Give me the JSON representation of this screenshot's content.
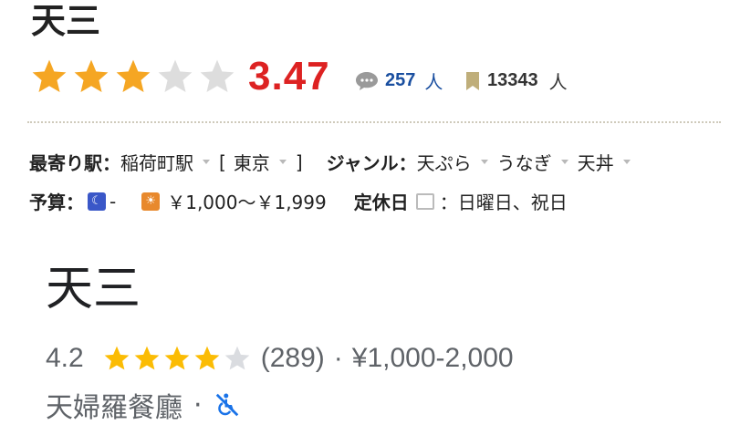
{
  "tabelog": {
    "name": "天三",
    "rating": "3.47",
    "stars_filled": 3,
    "stars_total": 5,
    "review_count": "257",
    "review_unit": "人",
    "save_count": "13343",
    "save_unit": "人",
    "station_label": "最寄り駅：",
    "station_value": "稲荷町駅",
    "area_open": "[",
    "area_value": "東京",
    "area_close": "]",
    "genre_label": "ジャンル：",
    "genres": [
      "天ぷら",
      "うなぎ",
      "天丼"
    ],
    "budget_label": "予算：",
    "budget_dinner": "-",
    "budget_lunch": "￥1,000～￥1,999",
    "holiday_label": "定休日",
    "holiday_colon": "：",
    "holiday_value": "日曜日、祝日",
    "colors": {
      "rating": "#dd2222",
      "star": "#f5a623",
      "star_empty": "#dddddd",
      "link": "#1a4fa0"
    },
    "icons": [
      "speech-bubble-icon",
      "bookmark-icon",
      "moon-icon",
      "sun-icon",
      "calendar-note-icon",
      "dropdown-arrow-icon"
    ]
  },
  "google": {
    "name": "天三",
    "rating": "4.2",
    "stars_filled": 4,
    "stars_total": 5,
    "review_count": "(289)",
    "separator": "·",
    "price_range": "¥1,000-2,000",
    "category": "天婦羅餐廳",
    "category_sep": "·",
    "colors": {
      "star": "#fbbc04",
      "star_empty": "#dadce0",
      "accessibility": "#1a73e8"
    },
    "icons": [
      "not-wheelchair-accessible-icon"
    ]
  }
}
